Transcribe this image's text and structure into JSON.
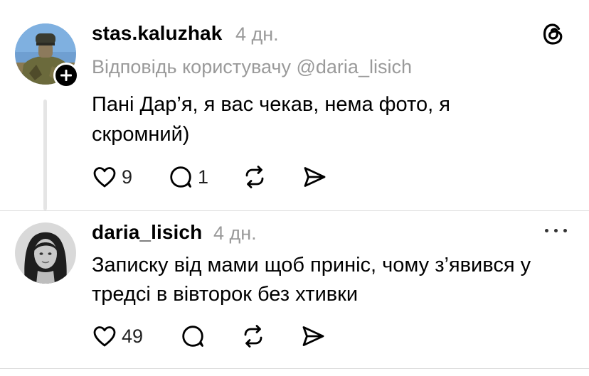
{
  "posts": [
    {
      "username": "stas.kaluzhak",
      "time": "4 дн.",
      "reply_to": "Відповідь користувачу @daria_lisich",
      "text_lines": [
        "Пані Дар’я, я вас чекав, нема фото, я",
        "скромний)"
      ],
      "likes": "9",
      "replies": "1",
      "avatar_icon": "avatar-photo",
      "follow_icon": "plus-icon"
    },
    {
      "username": "daria_lisich",
      "time": "4 дн.",
      "text_lines": [
        "Записку від мами щоб приніс, чому з’явився у",
        "тредсі в вівторок без хтивки"
      ],
      "likes": "49",
      "replies": "",
      "avatar_icon": "avatar-photo"
    }
  ],
  "header": {
    "app_icon": "threads-logo-icon"
  },
  "colors": {
    "text": "#000000",
    "muted": "#9a9a9a",
    "divider": "#dddddd",
    "thread_line": "#e5e5e5"
  }
}
